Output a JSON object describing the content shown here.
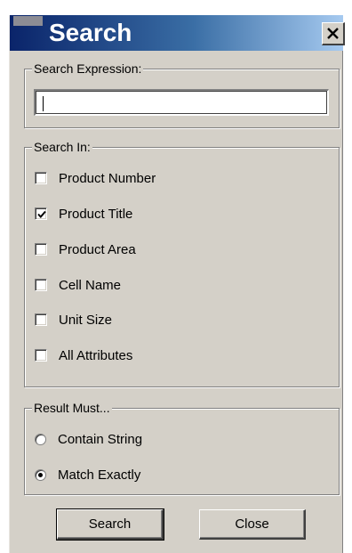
{
  "window": {
    "title": "Search",
    "close_symbol": "X"
  },
  "search_expression": {
    "legend": "Search Expression:",
    "value": "",
    "placeholder": ""
  },
  "search_in": {
    "legend": "Search In:",
    "options": [
      {
        "label": "Product Number",
        "checked": false
      },
      {
        "label": "Product Title",
        "checked": true
      },
      {
        "label": "Product Area",
        "checked": false
      },
      {
        "label": "Cell Name",
        "checked": false
      },
      {
        "label": "Unit Size",
        "checked": false
      },
      {
        "label": "All Attributes",
        "checked": false
      }
    ]
  },
  "result_must": {
    "legend": "Result Must...",
    "options": [
      {
        "label": "Contain String",
        "selected": false
      },
      {
        "label": "Match Exactly",
        "selected": true
      }
    ]
  },
  "buttons": {
    "search_label": "Search",
    "close_label": "Close"
  },
  "colors": {
    "title_gradient_start": "#0a246a",
    "title_gradient_end": "#a6caf0",
    "face": "#d4d0c8"
  },
  "icons": {
    "window_icon": "app-icon",
    "close": "close-icon",
    "check": "checkmark-icon"
  }
}
